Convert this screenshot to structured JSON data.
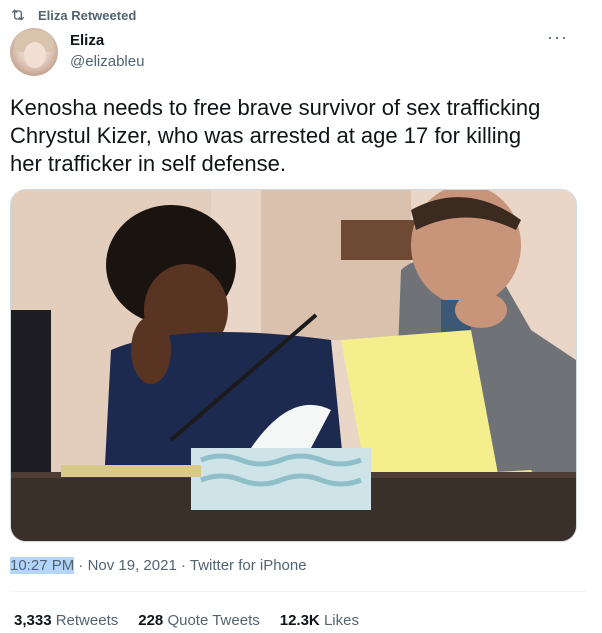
{
  "retweet": {
    "icon": "retweet-icon",
    "label": "Eliza Retweeted"
  },
  "author": {
    "name": "Eliza",
    "handle": "@elizableu",
    "avatar_icon": "avatar"
  },
  "more_icon": "more-dots-icon",
  "more_glyph": "···",
  "tweet": {
    "text": "Kenosha needs to free brave survivor of sex trafficking\nChrystul Kizer, who was arrested at age 17 for killing\nher trafficker in self defense."
  },
  "media": {
    "type": "photo"
  },
  "meta": {
    "time": "10:27 PM",
    "sep1": " · ",
    "date": "Nov 19, 2021",
    "sep2": " · ",
    "source": "Twitter for iPhone"
  },
  "stats": {
    "retweets_count": "3,333",
    "retweets_label": "Retweets",
    "quotes_count": "228",
    "quotes_label": "Quote Tweets",
    "likes_count": "12.3K",
    "likes_label": "Likes"
  },
  "colors": {
    "text": "#0f1419",
    "secondary": "#536471",
    "selection": "#b4d5fe",
    "border": "#eff3f4"
  }
}
